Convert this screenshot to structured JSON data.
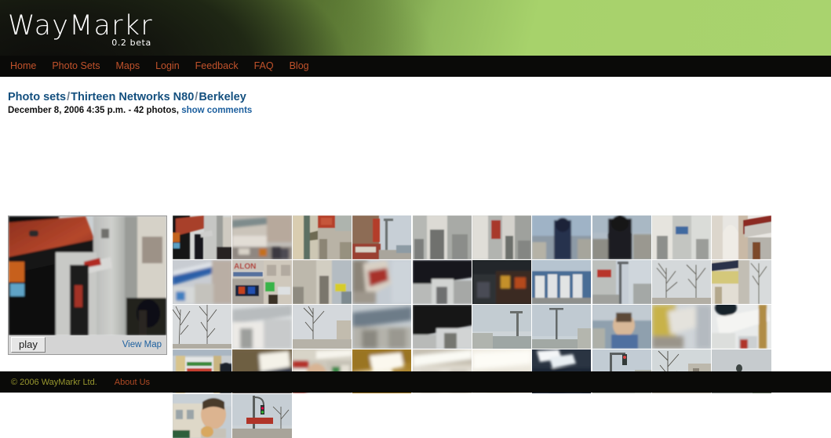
{
  "site": {
    "logo_text": "WayMarkr",
    "version_label": "0.2 beta",
    "brand_green": "#a7d26b",
    "nav_link_color": "#c1522b",
    "link_blue": "#1c5f9e",
    "heading_blue": "#14507f",
    "footer_copyright_color": "#98972f",
    "footer_link_color": "#b04a25"
  },
  "nav": {
    "items": [
      {
        "label": "Home"
      },
      {
        "label": "Photo Sets"
      },
      {
        "label": "Maps"
      },
      {
        "label": "Login"
      },
      {
        "label": "Feedback"
      },
      {
        "label": "FAQ"
      },
      {
        "label": "Blog"
      }
    ]
  },
  "breadcrumb": {
    "root": "Photo sets",
    "sep1": "/",
    "device": "Thirteen Networks N80",
    "sep2": "/",
    "place": "Berkeley"
  },
  "meta": {
    "datetime": "December 8, 2006 4:35 p.m.",
    "dash": "-",
    "photo_count": "42 photos,",
    "comments_link": "show comments"
  },
  "player": {
    "play_label": "play",
    "view_map_label": "View Map"
  },
  "gallery": {
    "columns": 10,
    "total_thumbnails": 42,
    "thumbnails": [
      {
        "id": 1,
        "scene": "red awning storefront"
      },
      {
        "id": 2,
        "scene": "blurred shopfront facade"
      },
      {
        "id": 3,
        "scene": "beige building with red sign"
      },
      {
        "id": 4,
        "scene": "brick building with street pole"
      },
      {
        "id": 5,
        "scene": "shop windows grey"
      },
      {
        "id": 6,
        "scene": "storefront with red banner"
      },
      {
        "id": 7,
        "scene": "blue sky and pedestrian"
      },
      {
        "id": 8,
        "scene": "person silhouette dark"
      },
      {
        "id": 9,
        "scene": "white building with signs"
      },
      {
        "id": 10,
        "scene": "white arcade overhang"
      },
      {
        "id": 11,
        "scene": "blue awning blurred"
      },
      {
        "id": 12,
        "scene": "salon storefront signage"
      },
      {
        "id": 13,
        "scene": "shop row with yellow sign"
      },
      {
        "id": 14,
        "scene": "motion blurred figure"
      },
      {
        "id": 15,
        "scene": "dark awning close-up"
      },
      {
        "id": 16,
        "scene": "neon shop interior"
      },
      {
        "id": 17,
        "scene": "blue wall with posters"
      },
      {
        "id": 18,
        "scene": "red sign and street pole"
      },
      {
        "id": 19,
        "scene": "bare trees and sky"
      },
      {
        "id": 20,
        "scene": "shop canopy and trees"
      },
      {
        "id": 21,
        "scene": "branches over grey sky"
      },
      {
        "id": 22,
        "scene": "blurred white facade"
      },
      {
        "id": 23,
        "scene": "bare tree winter sky"
      },
      {
        "id": 24,
        "scene": "blurred motion street"
      },
      {
        "id": 25,
        "scene": "dark awning underside"
      },
      {
        "id": 26,
        "scene": "overcast sky street"
      },
      {
        "id": 27,
        "scene": "sky with utility pole"
      },
      {
        "id": 28,
        "scene": "man in blue shirt"
      },
      {
        "id": 29,
        "scene": "yellow sign blur"
      },
      {
        "id": 30,
        "scene": "blue and white interior"
      },
      {
        "id": 31,
        "scene": "store shelves interior"
      },
      {
        "id": 32,
        "scene": "ceiling lights blur"
      },
      {
        "id": 33,
        "scene": "interior motion blur"
      },
      {
        "id": 34,
        "scene": "bright ceiling panel"
      },
      {
        "id": 35,
        "scene": "fluorescent light streak"
      },
      {
        "id": 36,
        "scene": "bright white blur"
      },
      {
        "id": 37,
        "scene": "ceiling lights dark room"
      },
      {
        "id": 38,
        "scene": "traffic light and sky"
      },
      {
        "id": 39,
        "scene": "bare tree and building"
      },
      {
        "id": 40,
        "scene": "grey sky with pole"
      },
      {
        "id": 41,
        "scene": "man with coffee cup"
      },
      {
        "id": 42,
        "scene": "street sign and tree"
      }
    ]
  },
  "footer": {
    "copyright": "© 2006 WayMarkr Ltd.",
    "about_label": "About Us"
  }
}
